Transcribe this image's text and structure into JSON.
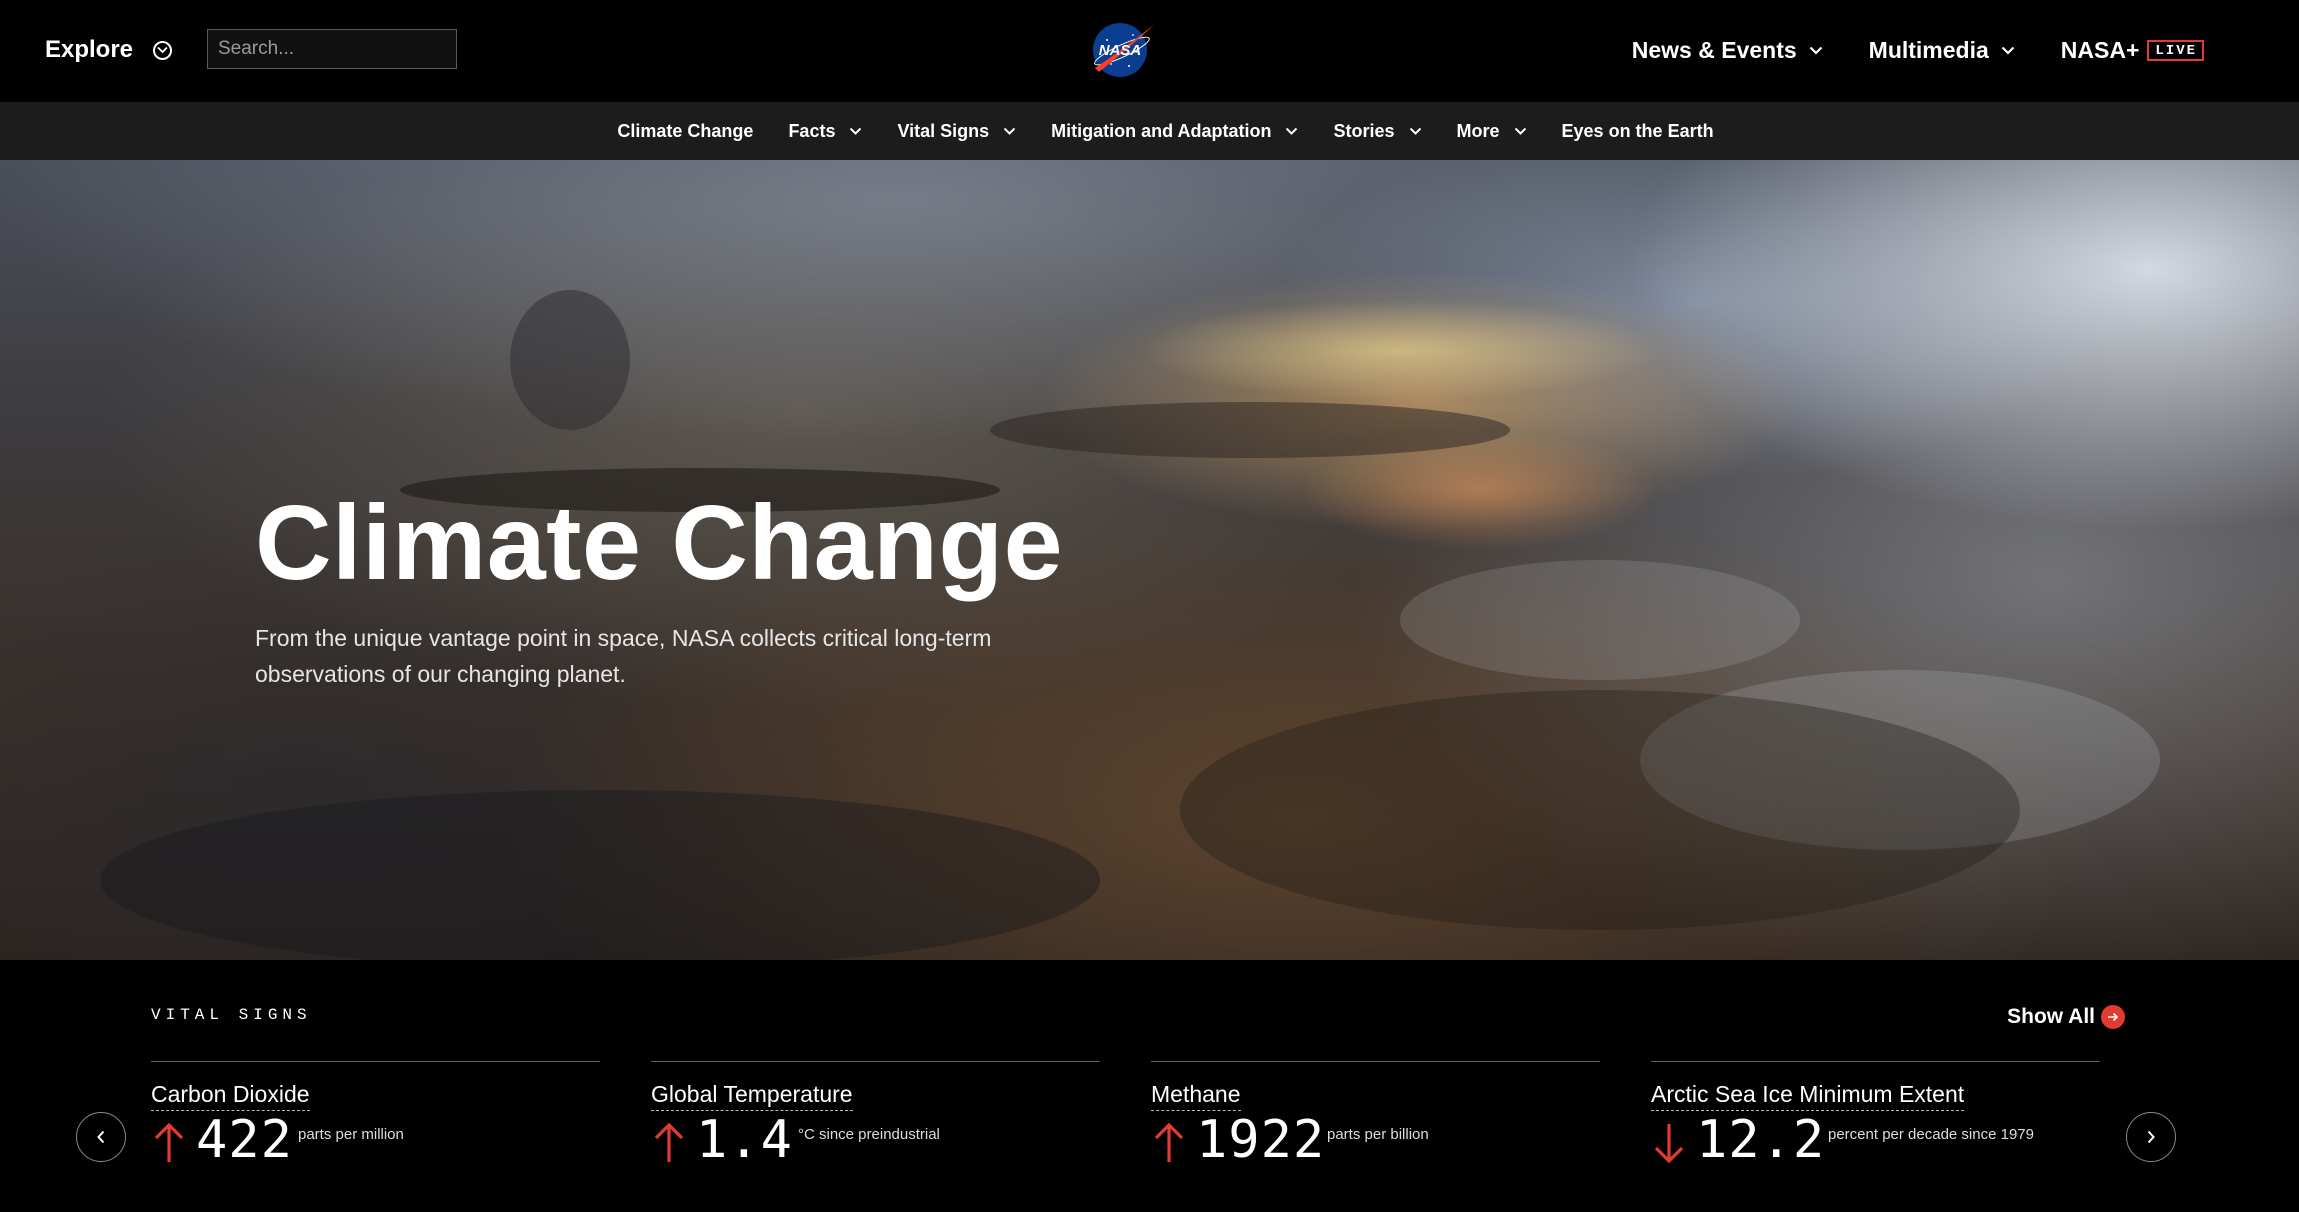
{
  "header": {
    "explore_label": "Explore",
    "search_placeholder": "Search...",
    "logo_text": "NASA",
    "right_nav": [
      {
        "label": "News & Events"
      },
      {
        "label": "Multimedia"
      },
      {
        "label": "NASA+",
        "badge": "LIVE"
      }
    ]
  },
  "subnav": {
    "items": [
      {
        "label": "Climate Change",
        "has_dropdown": false
      },
      {
        "label": "Facts",
        "has_dropdown": true
      },
      {
        "label": "Vital Signs",
        "has_dropdown": true
      },
      {
        "label": "Mitigation and Adaptation",
        "has_dropdown": true
      },
      {
        "label": "Stories",
        "has_dropdown": true
      },
      {
        "label": "More",
        "has_dropdown": true
      },
      {
        "label": "Eyes on the Earth",
        "has_dropdown": false
      }
    ]
  },
  "hero": {
    "title": "Climate Change",
    "subtitle": "From the unique vantage point in space, NASA collects critical long-term observations of our changing planet."
  },
  "vital_signs": {
    "title": "VITAL SIGNS",
    "show_all_label": "Show All",
    "cards": [
      {
        "title": "Carbon Dioxide",
        "value": "422",
        "unit": "parts per million",
        "trend": "up"
      },
      {
        "title": "Global Temperature",
        "value": "1.4",
        "unit": "°C since preindustrial",
        "trend": "up"
      },
      {
        "title": "Methane",
        "value": "1922",
        "unit": "parts per billion",
        "trend": "up"
      },
      {
        "title": "Arctic Sea Ice Minimum Extent",
        "value": "12.2",
        "unit": "percent per decade since 1979",
        "trend": "down"
      }
    ]
  },
  "colors": {
    "accent_red": "#e23c32",
    "nasa_blue": "#0b3d91",
    "header_bg": "#000000",
    "subnav_bg": "#1c1c1c"
  },
  "icons": {
    "explore": "circle-chevron-down-icon",
    "dropdown": "chevron-down-icon",
    "show_all": "arrow-right-circle-icon",
    "trend_up": "arrow-up-icon",
    "trend_down": "arrow-down-icon",
    "carousel_prev": "chevron-left-icon",
    "carousel_next": "chevron-right-icon"
  }
}
